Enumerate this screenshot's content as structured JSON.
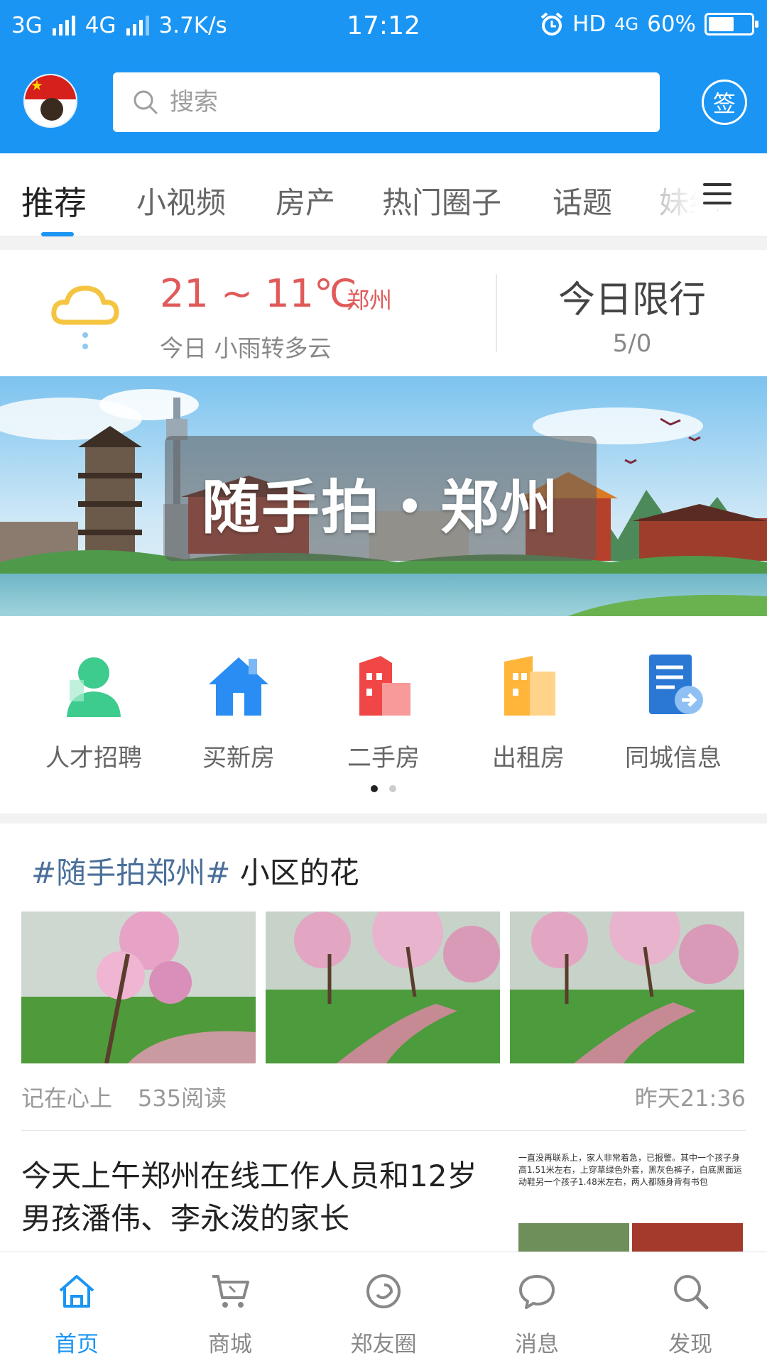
{
  "status_bar": {
    "network1": "3G",
    "network2": "4G",
    "speed": "3.7K/s",
    "time": "17:12",
    "hd": "HD",
    "network3": "4G",
    "battery": "60%",
    "battery_level": 0.6
  },
  "header": {
    "search_placeholder": "搜索",
    "checkin_label": "签"
  },
  "tabs": [
    {
      "label": "推荐",
      "active": true
    },
    {
      "label": "小视频"
    },
    {
      "label": "房产"
    },
    {
      "label": "热门圈子"
    },
    {
      "label": "话题"
    },
    {
      "label": "妹纸"
    }
  ],
  "weather": {
    "temperature": "21 ~ 11℃",
    "city": "郑州",
    "description": "今日 小雨转多云",
    "limit_title": "今日限行",
    "limit_value": "5/0"
  },
  "banner": {
    "caption": "随手拍・郑州"
  },
  "quick_links": [
    {
      "label": "人才招聘",
      "icon": "person-icon"
    },
    {
      "label": "买新房",
      "icon": "house-icon"
    },
    {
      "label": "二手房",
      "icon": "building-red-icon"
    },
    {
      "label": "出租房",
      "icon": "building-orange-icon"
    },
    {
      "label": "同城信息",
      "icon": "document-arrow-icon"
    }
  ],
  "feed": {
    "post1": {
      "tag": "#随手拍郑州#",
      "title": " 小区的花",
      "author": "记在心上",
      "reads": "535阅读",
      "time": "昨天21:36"
    },
    "post2": {
      "headline": "今天上午郑州在线工作人员和12岁男孩潘伟、李永泼的家长",
      "image_text": "一直没再联系上，家人非常着急，已报警。其中一个孩子身高1.51米左右，上穿草绿色外套，黑灰色裤子，白底黑面运动鞋另一个孩子1.48米左右，两人都随身背有书包"
    }
  },
  "bottom_nav": [
    {
      "label": "首页",
      "icon": "home-icon",
      "active": true
    },
    {
      "label": "商城",
      "icon": "cart-icon"
    },
    {
      "label": "郑友圈",
      "icon": "circle-chat-icon"
    },
    {
      "label": "消息",
      "icon": "message-icon"
    },
    {
      "label": "发现",
      "icon": "search-icon"
    }
  ],
  "colors": {
    "brand": "#1a95f4",
    "temperature": "#e05a5a",
    "tag": "#4a6f9a"
  }
}
